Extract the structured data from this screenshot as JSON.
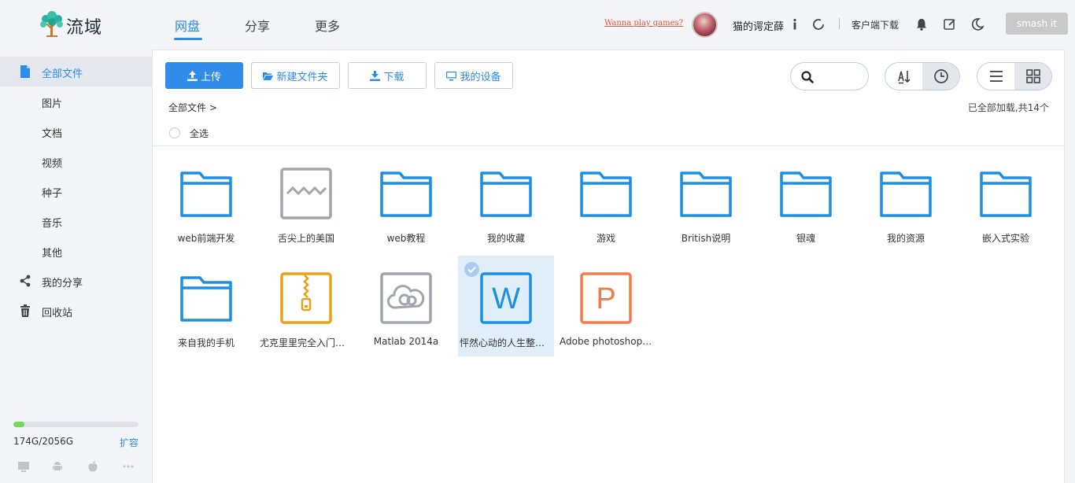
{
  "header": {
    "logo_text": "流域",
    "tabs": [
      {
        "label": "网盘",
        "active": true
      },
      {
        "label": "分享",
        "active": false
      },
      {
        "label": "更多",
        "active": false
      }
    ],
    "games_link": "Wanna play games?",
    "username": "猫的谔定薛",
    "client_download": "客户端下载",
    "smash_button": "smash it",
    "icons": [
      "info-icon",
      "refresh-icon",
      "bell-icon",
      "edit-icon",
      "moon-icon"
    ]
  },
  "sidebar": {
    "items": [
      {
        "label": "全部文件",
        "icon": "file-icon",
        "active": true
      },
      {
        "label": "图片",
        "icon": "",
        "active": false
      },
      {
        "label": "文档",
        "icon": "",
        "active": false
      },
      {
        "label": "视频",
        "icon": "",
        "active": false
      },
      {
        "label": "种子",
        "icon": "",
        "active": false
      },
      {
        "label": "音乐",
        "icon": "",
        "active": false
      },
      {
        "label": "其他",
        "icon": "",
        "active": false
      },
      {
        "label": "我的分享",
        "icon": "share-icon",
        "active": false
      },
      {
        "label": "回收站",
        "icon": "trash-icon",
        "active": false
      }
    ],
    "storage": {
      "text": "174G/2056G",
      "used_fraction": 0.085,
      "expand_label": "扩容"
    },
    "devices": [
      "desktop-icon",
      "android-icon",
      "apple-icon",
      "more-icon"
    ]
  },
  "toolbar": {
    "upload": "上传",
    "new_folder": "新建文件夹",
    "download": "下载",
    "my_devices": "我的设备",
    "sort_icons": [
      "sort-az-icon",
      "clock-icon"
    ],
    "view_icons": [
      "list-view-icon",
      "grid-view-icon"
    ]
  },
  "breadcrumb": "全部文件 >",
  "loaded_text": "已全部加载,共14个",
  "select_all": "全选",
  "files": [
    {
      "name": "web前端开发",
      "type": "folder",
      "selected": false
    },
    {
      "name": "舌尖上的美国",
      "type": "image",
      "selected": false
    },
    {
      "name": "web教程",
      "type": "folder",
      "selected": false
    },
    {
      "name": "我的收藏",
      "type": "folder",
      "selected": false
    },
    {
      "name": "游戏",
      "type": "folder",
      "selected": false
    },
    {
      "name": "British说明",
      "type": "folder",
      "selected": false
    },
    {
      "name": "银魂",
      "type": "folder",
      "selected": false
    },
    {
      "name": "我的资源",
      "type": "folder",
      "selected": false
    },
    {
      "name": "嵌入式实验",
      "type": "folder",
      "selected": false
    },
    {
      "name": "来自我的手机",
      "type": "folder",
      "selected": false
    },
    {
      "name": "尤克里里完全入门手册",
      "type": "zip",
      "selected": false
    },
    {
      "name": "Matlab 2014a",
      "type": "cloud",
      "selected": false
    },
    {
      "name": "怦然心动的人生整理...",
      "type": "word",
      "selected": true
    },
    {
      "name": "Adobe photoshop ...",
      "type": "ppt",
      "selected": false
    }
  ],
  "colors": {
    "accent": "#2f8ce8",
    "folder": "#1a8fe3",
    "zip": "#e8a21a",
    "ppt": "#ef7d4f",
    "gray": "#a0a6ad",
    "storage_fill": "#6fd95a"
  }
}
